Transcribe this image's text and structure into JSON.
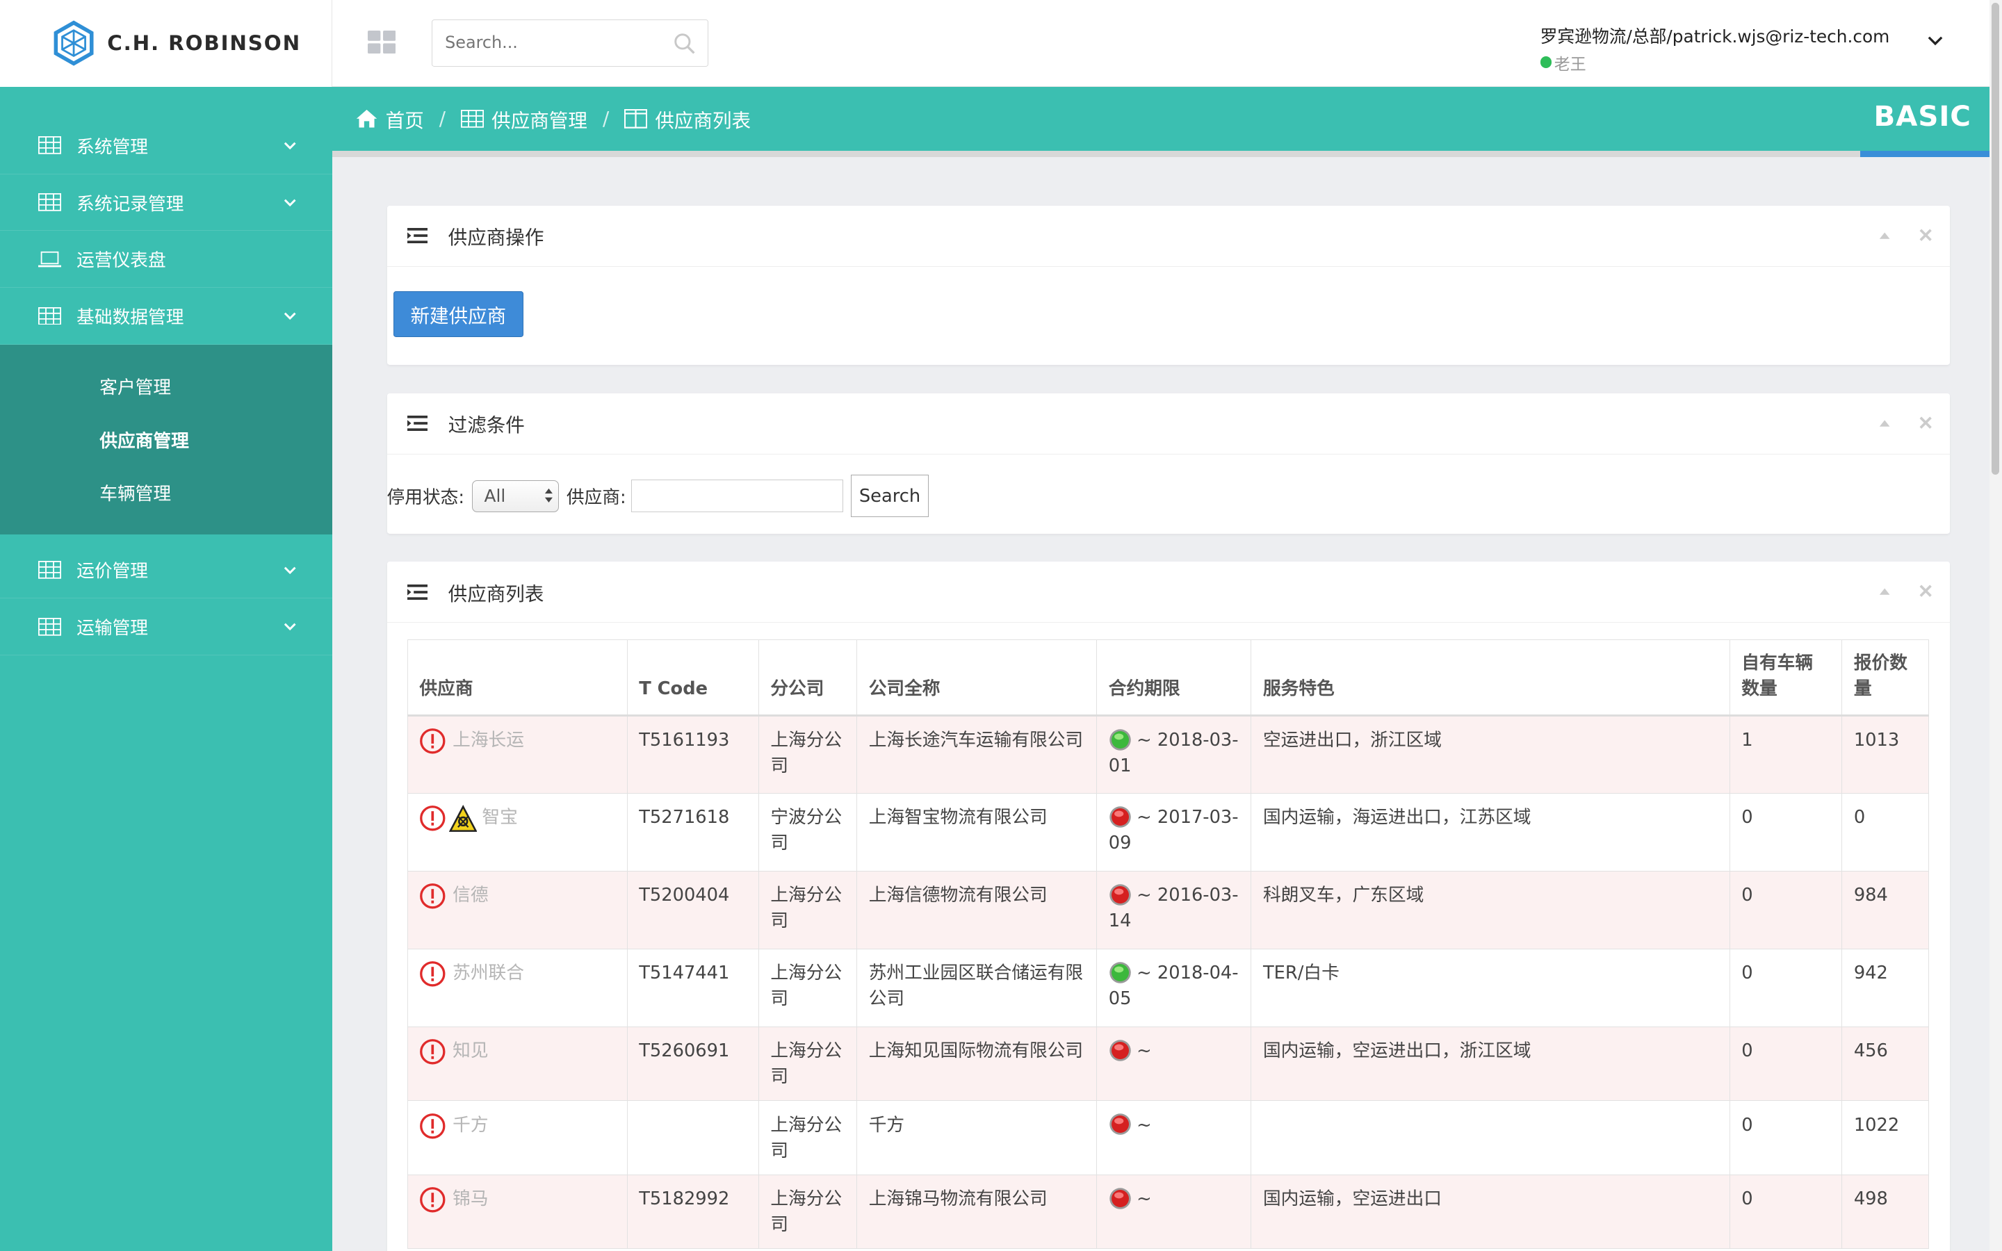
{
  "brand": {
    "name": "C.H. ROBINSON"
  },
  "sidebar": {
    "menu_top": [
      {
        "label": "系统管理",
        "icon": "table-icon",
        "has_arrow": true
      },
      {
        "label": "系统记录管理",
        "icon": "table-icon",
        "has_arrow": true
      },
      {
        "label": "运营仪表盘",
        "icon": "laptop-icon",
        "has_arrow": false
      },
      {
        "label": "基础数据管理",
        "icon": "table-icon",
        "has_arrow": true
      }
    ],
    "submenu": [
      {
        "label": "客户管理",
        "active": false
      },
      {
        "label": "供应商管理",
        "active": true
      },
      {
        "label": "车辆管理",
        "active": false
      }
    ],
    "menu_bottom": [
      {
        "label": "运价管理",
        "icon": "table-icon",
        "has_arrow": true
      },
      {
        "label": "运输管理",
        "icon": "table-icon",
        "has_arrow": true
      }
    ]
  },
  "topbar": {
    "search_placeholder": "Search...",
    "user": "罗宾逊物流/总部/patrick.wjs@riz-tech.com",
    "status": "老王"
  },
  "breadcrumb": {
    "items": [
      "首页",
      "供应商管理",
      "供应商列表"
    ],
    "separator": "/",
    "edition": "BASIC"
  },
  "ops_panel": {
    "title": "供应商操作",
    "new_button": "新建供应商"
  },
  "filter_panel": {
    "title": "过滤条件",
    "status_label": "停用状态:",
    "status_value": "All",
    "supplier_label": "供应商:",
    "search_button": "Search"
  },
  "list_panel": {
    "title": "供应商列表",
    "columns": [
      "供应商",
      "T Code",
      "分公司",
      "公司全称",
      "合约期限",
      "服务特色",
      "自有车辆数量",
      "报价数量"
    ],
    "rows": [
      {
        "name": "上海长运",
        "tcode": "T5161193",
        "branch": "上海分公司",
        "fullname": "上海长途汽车运输有限公司",
        "light": "green",
        "term": "~ 2018-03-01",
        "service": "空运进出口，浙江区域",
        "vehicles": "1",
        "quotes": "1013",
        "hazard": false
      },
      {
        "name": "智宝",
        "tcode": "T5271618",
        "branch": "宁波分公司",
        "fullname": "上海智宝物流有限公司",
        "light": "red",
        "term": "~ 2017-03-09",
        "service": "国内运输，海运进出口，江苏区域",
        "vehicles": "0",
        "quotes": "0",
        "hazard": true
      },
      {
        "name": "信德",
        "tcode": "T5200404",
        "branch": "上海分公司",
        "fullname": "上海信德物流有限公司",
        "light": "red",
        "term": "~ 2016-03-14",
        "service": "科朗叉车，广东区域",
        "vehicles": "0",
        "quotes": "984",
        "hazard": false
      },
      {
        "name": "苏州联合",
        "tcode": "T5147441",
        "branch": "上海分公司",
        "fullname": "苏州工业园区联合储运有限公司",
        "light": "green",
        "term": "~ 2018-04-05",
        "service": "TER/白卡",
        "vehicles": "0",
        "quotes": "942",
        "hazard": false
      },
      {
        "name": "知见",
        "tcode": "T5260691",
        "branch": "上海分公司",
        "fullname": "上海知见国际物流有限公司",
        "light": "red",
        "term": "~",
        "service": "国内运输，空运进出口，浙江区域",
        "vehicles": "0",
        "quotes": "456",
        "hazard": false
      },
      {
        "name": "千方",
        "tcode": "",
        "branch": "上海分公司",
        "fullname": "千方",
        "light": "red",
        "term": "~",
        "service": "",
        "vehicles": "0",
        "quotes": "1022",
        "hazard": false
      },
      {
        "name": "锦马",
        "tcode": "T5182992",
        "branch": "上海分公司",
        "fullname": "上海锦马物流有限公司",
        "light": "red",
        "term": "~",
        "service": "国内运输，空运进出口",
        "vehicles": "0",
        "quotes": "498",
        "hazard": false
      }
    ]
  },
  "colors": {
    "sidebar": "#3bbfb1",
    "submenu": "#2d9187",
    "primary_button": "#3e8bd8",
    "row_tint": "#fcf1f1",
    "warning": "#e02b2b"
  }
}
